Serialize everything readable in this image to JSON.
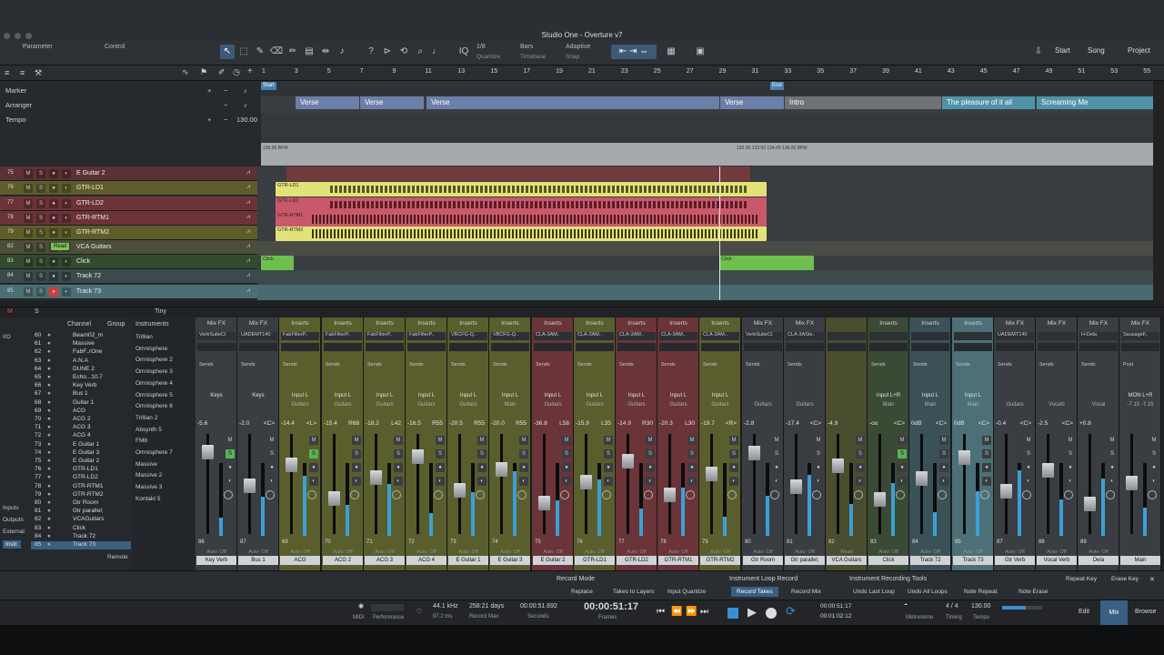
{
  "window": {
    "title": "Studio One - Overture v7"
  },
  "toolbar": {
    "parameter": "Parameter",
    "control": "Control",
    "quantize_value": "1/8",
    "quantize_label": "Quantize",
    "timebase_value": "Bars",
    "timebase_label": "Timebase",
    "snap_value": "Adaptive",
    "snap_label": "Snap",
    "nav": [
      "Start",
      "Song",
      "Project"
    ]
  },
  "ruler": {
    "bars": [
      "1",
      "3",
      "5",
      "7",
      "9",
      "11",
      "13",
      "15",
      "17",
      "19",
      "21",
      "23",
      "25",
      "27",
      "29",
      "31",
      "33",
      "35",
      "37",
      "39",
      "41",
      "43",
      "45",
      "47",
      "49",
      "51",
      "53",
      "55"
    ],
    "start_marker": "Start",
    "end_marker": "End"
  },
  "global_tracks": {
    "marker": "Marker",
    "arranger": "Arranger",
    "tempo": "Tempo",
    "tempo_value": "130.00",
    "tempo_markers": [
      "130.00 BPM",
      "132.00 133.00 134.00 136.00 BPM"
    ]
  },
  "arranger_sections": [
    "Verse",
    "Verse",
    "Verse",
    "Verse",
    "Intro",
    "The pleasure of it all",
    "Screaming Me"
  ],
  "tracks": [
    {
      "num": "75",
      "name": "E Guitar 2"
    },
    {
      "num": "76",
      "name": "GTR-LD1"
    },
    {
      "num": "77",
      "name": "GTR-LD2"
    },
    {
      "num": "78",
      "name": "GTR-RTM1"
    },
    {
      "num": "79",
      "name": "GTR-RTM2"
    },
    {
      "num": "82",
      "name": "VCA Guitars",
      "badge": "Read"
    },
    {
      "num": "83",
      "name": "Click"
    },
    {
      "num": "84",
      "name": "Track 72"
    },
    {
      "num": "85",
      "name": "Track 73"
    }
  ],
  "track_buttons": {
    "mute": "M",
    "solo": "S"
  },
  "clips": {
    "gtr_ld1": "GTR-LD1",
    "gtr_ld2": "GTR-LD2",
    "gtr_rtm1": "GTR-RTM1",
    "gtr_rtm2": "GTR-RTM2",
    "click": "Click",
    "acg": [
      "ACG 4",
      "ACG 4(2)",
      "ACG 4",
      "ACG 4(2)",
      "ACG 4(2)",
      "ACG 4(2)",
      "ACG 4(2)",
      "ACG 4(2)",
      "ACG 4(2)"
    ]
  },
  "tinybar": {
    "label": "Tiny",
    "m": "M",
    "s": "S"
  },
  "channel_list": {
    "header_channel": "Channel",
    "header_group": "Group",
    "side": [
      "I/O",
      "Inputs",
      "Outputs",
      "External",
      "Instr."
    ],
    "remote": "Remote",
    "rows": [
      [
        "60",
        "Beam02_m"
      ],
      [
        "61",
        "Massive"
      ],
      [
        "62",
        "FabF..rOne"
      ],
      [
        "63",
        "A.N.A"
      ],
      [
        "64",
        "DUNE 2"
      ],
      [
        "65",
        "Echo...10.7"
      ],
      [
        "66",
        "Key Verb"
      ],
      [
        "67",
        "Bus 1"
      ],
      [
        "68",
        "Guitar 1"
      ],
      [
        "69",
        "ACG"
      ],
      [
        "70",
        "ACG 2"
      ],
      [
        "71",
        "ACG 3"
      ],
      [
        "72",
        "ACG 4"
      ],
      [
        "73",
        "E Guitar 1"
      ],
      [
        "74",
        "E Guitar 3"
      ],
      [
        "75",
        "E Guitar 2"
      ],
      [
        "76",
        "GTR-LD1"
      ],
      [
        "77",
        "GTR-LD2"
      ],
      [
        "78",
        "GTR-RTM1"
      ],
      [
        "79",
        "GTR-RTM2"
      ],
      [
        "80",
        "Gtr Room"
      ],
      [
        "81",
        "Gtr parallel;"
      ],
      [
        "82",
        "VCAGuitars"
      ],
      [
        "83",
        "Click"
      ],
      [
        "84",
        "Track 72"
      ],
      [
        "85",
        "Track 73"
      ]
    ]
  },
  "instruments": {
    "header": "Instruments",
    "items": [
      "Trillian",
      "Omnisphere",
      "Omnisphere 2",
      "Omnisphere 3",
      "Omnisphere 4",
      "Omnisphere 5",
      "Omnisphere 6",
      "Trillian 2",
      "Absynth 5",
      "FM8",
      "Omnisphere 7",
      "Massive",
      "Massive 2",
      "Massive 3",
      "Kontakt 5"
    ]
  },
  "strips": [
    {
      "hdr": "Mix FX",
      "ins": "VerbSuiteCl.",
      "sends": "Sends",
      "inp": "Keys",
      "sub": "",
      "vol": "-5.6",
      "pan": "",
      "num": "86",
      "auto": "Auto: Off",
      "name": "Key Verb",
      "col": "#3a3d42"
    },
    {
      "hdr": "Mix FX",
      "ins": "UADEMT140",
      "sends": "Sends",
      "inp": "Keys",
      "sub": "",
      "vol": "-2.0",
      "pan": "<C>",
      "num": "87",
      "auto": "Auto: Off",
      "name": "Bus 1",
      "col": "#3a3d42"
    },
    {
      "hdr": "Inserts",
      "ins": "FabFilterP..",
      "sends": "Sends",
      "inp": "Input L",
      "sub": "Guitars",
      "vol": "-14.4",
      "pan": "<L>",
      "num": "69",
      "auto": "Auto: Off",
      "name": "ACG",
      "col": "#5a5e2c"
    },
    {
      "hdr": "Inserts",
      "ins": "FabFilterP..",
      "sends": "Sends",
      "inp": "Input L",
      "sub": "Guitars",
      "vol": "-15.4",
      "pan": "R68",
      "num": "70",
      "auto": "Auto: Off",
      "name": "ACG 2",
      "col": "#5a5e2c"
    },
    {
      "hdr": "Inserts",
      "ins": "FabFilterP..",
      "sends": "Sends",
      "inp": "Input L",
      "sub": "Guitars",
      "vol": "-18.2",
      "pan": "L42",
      "num": "71",
      "auto": "Auto: Off",
      "name": "ACG 3",
      "col": "#5a5e2c"
    },
    {
      "hdr": "Inserts",
      "ins": "FabFilterP..",
      "sends": "Sends",
      "inp": "Input L",
      "sub": "Guitars",
      "vol": "-16.5",
      "pan": "R55",
      "num": "72",
      "auto": "Auto: Off",
      "name": "ACG 4",
      "col": "#5a5e2c"
    },
    {
      "hdr": "Inserts",
      "ins": "VBCFG-Q..",
      "sends": "Sends",
      "inp": "Input L",
      "sub": "Guitars",
      "vol": "-20.5",
      "pan": "R55",
      "num": "73",
      "auto": "Auto: Off",
      "name": "E Guitar 1",
      "col": "#5a5e2c"
    },
    {
      "hdr": "Inserts",
      "ins": "VBCFG-Q..",
      "sends": "Sends",
      "inp": "Input L",
      "sub": "Main",
      "vol": "-20.0",
      "pan": "R55",
      "num": "74",
      "auto": "Auto: Off",
      "name": "E Guitar 3",
      "col": "#5a5e2c"
    },
    {
      "hdr": "Inserts",
      "ins": "CLA-3AM..",
      "sends": "Sends",
      "inp": "Input L",
      "sub": "Guitars",
      "vol": "-36.8",
      "pan": "L58",
      "num": "75",
      "auto": "Auto: Off",
      "name": "E Guitar 2",
      "col": "#6a3438"
    },
    {
      "hdr": "Inserts",
      "ins": "CLA-3AM..",
      "sends": "Sends",
      "inp": "Input L",
      "sub": "Guitars",
      "vol": "-15.9",
      "pan": "L35",
      "num": "76",
      "auto": "Auto: Off",
      "name": "GTR-LD1",
      "col": "#5a5e2c"
    },
    {
      "hdr": "Inserts",
      "ins": "CLA-3AM..",
      "sends": "Sends",
      "inp": "Input L",
      "sub": "Guitars",
      "vol": "-14.9",
      "pan": "R30",
      "num": "77",
      "auto": "Auto: Off",
      "name": "GTR-LD2",
      "col": "#6a3438"
    },
    {
      "hdr": "Inserts",
      "ins": "CLA-3AM..",
      "sends": "Sends",
      "inp": "Input L",
      "sub": "Guitars",
      "vol": "-20.3",
      "pan": "L30",
      "num": "78",
      "auto": "Auto: Off",
      "name": "GTR-RTM1",
      "col": "#6a3438"
    },
    {
      "hdr": "Inserts",
      "ins": "CLA-3AM..",
      "sends": "Sends",
      "inp": "Input L",
      "sub": "Guitars",
      "vol": "-19.7",
      "pan": "<R>",
      "num": "79",
      "auto": "Auto: Off",
      "name": "GTR-RTM2",
      "col": "#5a5e2c"
    },
    {
      "hdr": "Mix FX",
      "ins": "VerbSuiteCl.",
      "sends": "Sends",
      "inp": "",
      "sub": "Guitars",
      "vol": "-2.8",
      "pan": "",
      "num": "80",
      "auto": "Auto: Off",
      "name": "Gtr Room",
      "col": "#3a3d42"
    },
    {
      "hdr": "Mix FX",
      "ins": "CLA-3ASte..",
      "sends": "Sends",
      "inp": "",
      "sub": "Guitars",
      "vol": "-17.4",
      "pan": "<C>",
      "num": "81",
      "auto": "Auto: Off",
      "name": "Gtr parallel;",
      "col": "#3a3d42"
    },
    {
      "hdr": "",
      "ins": "",
      "sends": "",
      "inp": "",
      "sub": "",
      "vol": "-4.9",
      "pan": "",
      "num": "82",
      "auto": "Read",
      "name": "VCA Guitars",
      "col": "#4a4d2e"
    },
    {
      "hdr": "Inserts",
      "ins": "",
      "sends": "Sends",
      "inp": "Input L+R",
      "sub": "Main",
      "vol": "-oo",
      "pan": "<C>",
      "num": "83",
      "auto": "Auto: Off",
      "name": "Click",
      "col": "#3b4a34"
    },
    {
      "hdr": "Inserts",
      "ins": "",
      "sends": "Sends",
      "inp": "Input L",
      "sub": "Main",
      "vol": "0dB",
      "pan": "<C>",
      "num": "84",
      "auto": "Auto: Off",
      "name": "Track 72",
      "col": "#3a5257"
    },
    {
      "hdr": "Inserts",
      "ins": "",
      "sends": "Sends",
      "inp": "Input L",
      "sub": "Main",
      "vol": "0dB",
      "pan": "<C>",
      "num": "85",
      "auto": "Auto: Off",
      "name": "Track 73",
      "col": "#4c7077"
    },
    {
      "hdr": "Mix FX",
      "ins": "UADEMT140",
      "sends": "Sends",
      "inp": "",
      "sub": "Guitars",
      "vol": "-0.4",
      "pan": "<C>",
      "num": "87",
      "auto": "Auto: Off",
      "name": "Gtr Verb",
      "col": "#3a3d42"
    },
    {
      "hdr": "Mix FX",
      "ins": "",
      "sends": "Sends",
      "inp": "",
      "sub": "Vocals",
      "vol": "-2.5",
      "pan": "<C>",
      "num": "88",
      "auto": "Auto: Off",
      "name": "Vocal Verb",
      "col": "#3a3d42"
    },
    {
      "hdr": "Mix FX",
      "ins": "H-Dela",
      "sends": "Sends",
      "inp": "",
      "sub": "Vocal",
      "vol": "+0.8",
      "pan": "",
      "num": "89",
      "auto": "Auto: Off",
      "name": "Dela",
      "col": "#3a3d42"
    },
    {
      "hdr": "Mix FX",
      "ins": "SausageF..",
      "sends": "Post",
      "inp": "MON L+R",
      "sub": "-7.15  -7.15",
      "vol": "",
      "pan": "",
      "num": "",
      "auto": "",
      "name": "Main",
      "col": "#3a3d42"
    }
  ],
  "strip_buttons": {
    "m": "M",
    "s": "S"
  },
  "bottom": {
    "record_mode": "Record Mode",
    "replace": "Replace",
    "takes_to_layers": "Takes to Layers",
    "input_quantize": "Input Quantize",
    "instr_loop": "Instrument Loop Record",
    "record_takes": "Record Takes",
    "record_mix": "Record Mix",
    "instr_tools": "Instrument Recording Tools",
    "undo_last_loop": "Undo Last Loop",
    "undo_all_loops": "Undo All Loops",
    "note_repeat": "Note Repeat",
    "note_erase": "Note Erase",
    "repeat_key": "Repeat Key",
    "erase_key": "Erase Key"
  },
  "transport": {
    "midi": "MIDI",
    "performance": "Performance",
    "sample_rate": "44.1 kHz",
    "latency": "97.2 ms",
    "record_max_val": "258:21 days",
    "record_max": "Record Max",
    "seconds_val": "00:00:51.692",
    "seconds": "Seconds",
    "frames_val": "00:00:51:17",
    "frames": "Frames",
    "loop_start": "00:00:51:17",
    "loop_end": "00:01:02:12",
    "metronome": "Metronome",
    "timing_val": "4 / 4",
    "timing": "Timing",
    "tempo_val": "130.00",
    "tempo": "Tempo",
    "edit": "Edit",
    "mix": "Mix",
    "browse": "Browse"
  }
}
